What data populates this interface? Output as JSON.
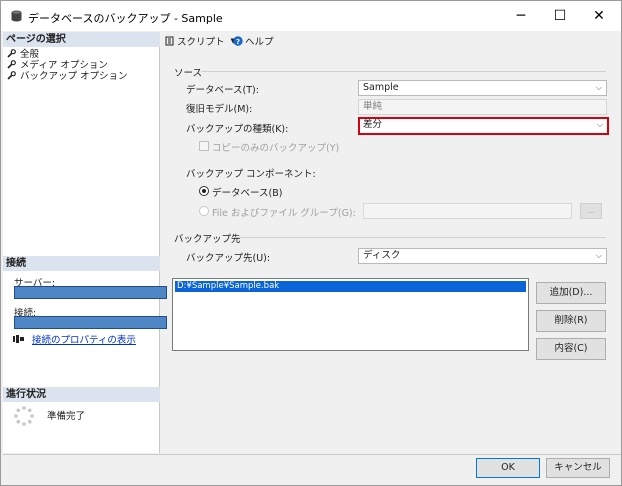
{
  "window": {
    "title": "データベースのバックアップ - Sample",
    "minimize_glyph": "─",
    "maximize_glyph": "☐",
    "close_glyph": "✕"
  },
  "left_pane": {
    "select_page_header": "ページの選択",
    "nav_items": [
      "全般",
      "メディア オプション",
      "バックアップ オプション"
    ],
    "connection_header": "接続",
    "server_label": "サーバー:",
    "connection_label": "接続:",
    "connection_properties_link": "接続のプロパティの表示",
    "progress_header": "進行状況",
    "progress_status": "準備完了"
  },
  "toolbar": {
    "script_label": "スクリプト",
    "help_label": "ヘルプ"
  },
  "source": {
    "group_label": "ソース",
    "database_label": "データベース(T):",
    "database_value": "Sample",
    "recovery_model_label": "復旧モデル(M):",
    "recovery_model_value": "単純",
    "backup_type_label": "バックアップの種類(K):",
    "backup_type_value": "差分",
    "copy_only_label": "コピーのみのバックアップ(Y)",
    "copy_only_checked": false
  },
  "backup_component": {
    "label": "バックアップ コンポーネント:",
    "database_option": "データベース(B)",
    "file_option": "File およびファイル グループ(G):",
    "selected": "database",
    "browse_label": "..."
  },
  "destination": {
    "group_label": "バックアップ先",
    "backup_to_label": "バックアップ先(U):",
    "backup_to_value": "ディスク",
    "files": [
      "D:¥Sample¥Sample.bak"
    ],
    "add_button": "追加(D)...",
    "remove_button": "削除(R)",
    "contents_button": "内容(C)"
  },
  "footer": {
    "ok_button": "OK",
    "cancel_button": "キャンセル"
  },
  "colors": {
    "highlight_border": "#d9000d",
    "selection": "#0a64d8",
    "section_header": "#dbe3ee",
    "link": "#0033cc"
  }
}
